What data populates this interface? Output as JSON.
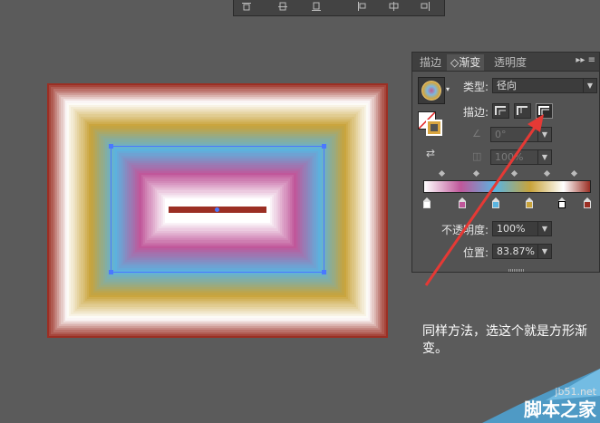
{
  "panel": {
    "tabs": [
      "描边",
      "◇渐变",
      "透明度"
    ],
    "active_tab_index": 1,
    "menu_icon": "panel-menu-icon",
    "type_label": "类型:",
    "type_value": "径向",
    "stroke_label": "描边:",
    "angle_value": "0°",
    "aspect_value": "100%",
    "opacity_label": "不透明度:",
    "opacity_value": "100%",
    "location_label": "位置:",
    "location_value": "83.87%"
  },
  "gradient_stops": [
    {
      "color": "#ffffff",
      "position": 0.0
    },
    {
      "color": "#c0579a",
      "position": 0.22
    },
    {
      "color": "#5ab4e0",
      "position": 0.43
    },
    {
      "color": "#c9a33a",
      "position": 0.64
    },
    {
      "color": "#ffffff",
      "position": 0.84
    },
    {
      "color": "#9b2f24",
      "position": 1.0
    }
  ],
  "caption": "同样方法，选这个就是方形渐变。",
  "watermark": {
    "site": "jb51.net",
    "name": "脚本之家"
  },
  "colors": {
    "background": "#5b5b5b",
    "panel": "#535353",
    "arrow": "#e53935",
    "selection": "#4a78ff"
  }
}
